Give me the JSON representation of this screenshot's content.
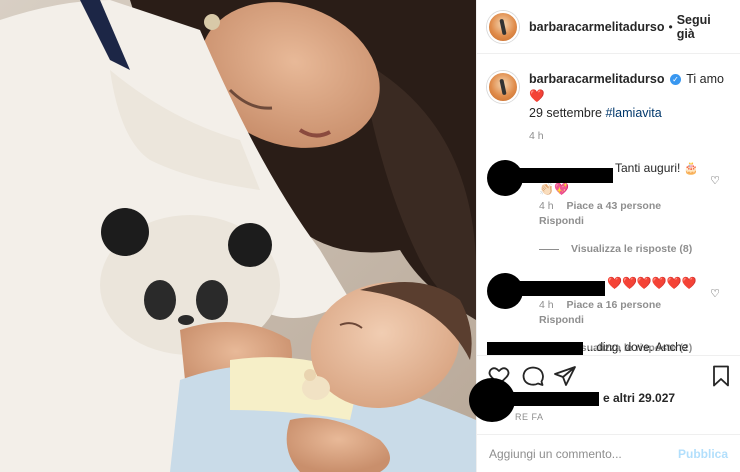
{
  "post": {
    "username": "barbaracarmelitadurso",
    "follow_label": "Segui già",
    "dot": "•"
  },
  "caption": {
    "username": "barbaracarmelitadurso",
    "text_main": "Ti amo",
    "heart": "❤️",
    "text_date": "29 settembre",
    "hashtag": "#lamiavita",
    "time": "4 h"
  },
  "comments": [
    {
      "text": "Tanti auguri! 🎂",
      "text2": "👏🏻💖",
      "time": "4 h",
      "likes": "Piace a 43 persone",
      "reply": "Rispondi",
      "view_replies": "Visualizza le risposte (8)"
    },
    {
      "text": "❤️❤️❤️❤️❤️❤️",
      "time": "4 h",
      "likes": "Piace a 16 persone",
      "reply": "Rispondi",
      "view_replies": "Visualizza le risposte (2)"
    }
  ],
  "partial_comment": "...ding, dove. Anche",
  "likes_text": "e altri 29.027",
  "ago_text": "RE FA",
  "comment_input": {
    "placeholder": "Aggiungi un commento...",
    "publish_label": "Pubblica"
  },
  "icons": {
    "like": "heart-outline-icon",
    "comment": "comment-bubble-icon",
    "share": "paper-plane-icon",
    "save": "bookmark-icon",
    "verified": "verified-badge-icon"
  },
  "colors": {
    "verified": "#3897f0",
    "heart": "#e0245e",
    "muted": "#8e8e8e",
    "publish": "#b2dffc"
  }
}
